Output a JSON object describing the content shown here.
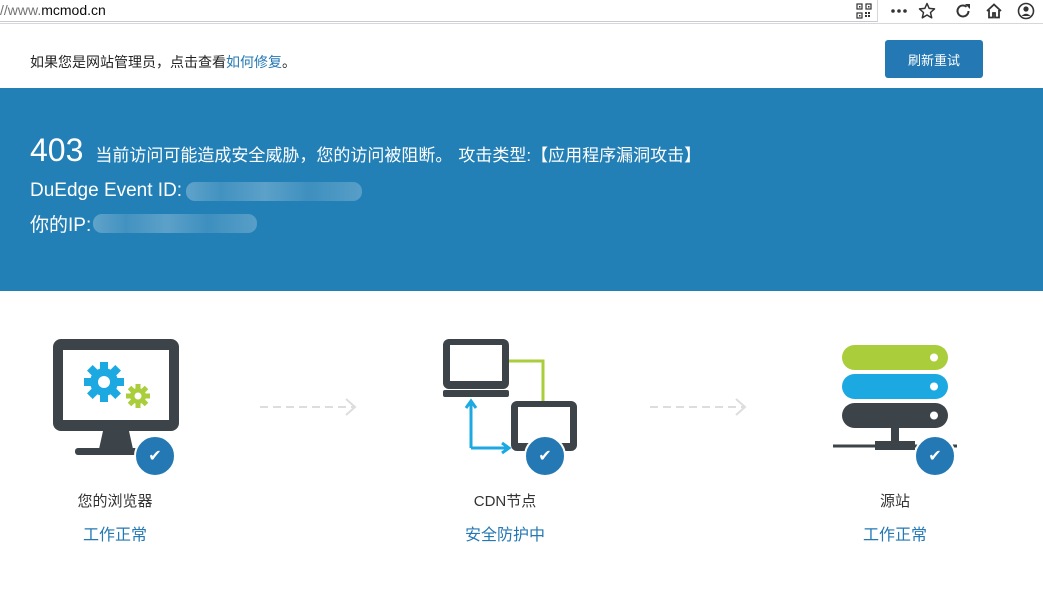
{
  "browser": {
    "url_prefix": "//www.",
    "url_domain": "mcmod.cn",
    "icons": [
      "qr-code-icon",
      "more-icon",
      "star-icon",
      "reload-icon",
      "home-icon",
      "account-icon"
    ]
  },
  "notice": {
    "text_prefix": "如果您是网站管理员，点击查看",
    "link_text": "如何修复",
    "text_suffix": "。",
    "refresh_label": "刷新重试"
  },
  "error": {
    "code": "403",
    "message": "当前访问可能造成安全威胁，您的访问被阻断。",
    "type_text": "攻击类型:【应用程序漏洞攻击】",
    "event_id_label": "DuEdge Event ID:",
    "ip_label": "你的IP:"
  },
  "nodes": [
    {
      "name": "您的浏览器",
      "status": "工作正常",
      "icon": "monitor-gears-icon"
    },
    {
      "name": "CDN节点",
      "status": "安全防护中",
      "icon": "network-icon"
    },
    {
      "name": "源站",
      "status": "工作正常",
      "icon": "server-icon"
    }
  ],
  "colors": {
    "primary": "#2478b4",
    "banner": "#2380b6",
    "green": "#aacd3c",
    "cyan": "#1ca9e1",
    "dark": "#3d4449"
  }
}
